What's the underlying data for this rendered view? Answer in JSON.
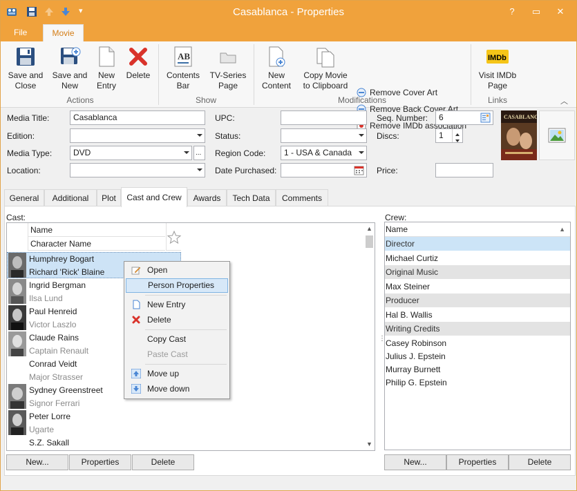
{
  "window": {
    "title": "Casablanca - Properties",
    "controls": {
      "help": "?",
      "restore": "▭",
      "close": "✕"
    }
  },
  "menu": {
    "file": "File",
    "movie": "Movie"
  },
  "ribbon": {
    "actions": {
      "label": "Actions",
      "save_close": [
        "Save and",
        "Close"
      ],
      "save_new": [
        "Save and",
        "New"
      ],
      "new_entry": [
        "New",
        "Entry"
      ],
      "delete": "Delete"
    },
    "show": {
      "label": "Show",
      "contents_bar": [
        "Contents",
        "Bar"
      ],
      "tv_series": [
        "TV-Series",
        "Page"
      ]
    },
    "modifications": {
      "label": "Modifications",
      "new_content": [
        "New",
        "Content"
      ],
      "copy_movie": [
        "Copy Movie",
        "to Clipboard"
      ],
      "remove_cover": "Remove Cover Art",
      "remove_back": "Remove Back Cover Art",
      "remove_imdb": "Remove IMDb association"
    },
    "links": {
      "label": "Links",
      "visit_imdb": [
        "Visit IMDb",
        "Page"
      ],
      "imdb_logo": "IMDb"
    }
  },
  "fields": {
    "media_title": {
      "label": "Media Title:",
      "value": "Casablanca"
    },
    "edition": {
      "label": "Edition:",
      "value": ""
    },
    "media_type": {
      "label": "Media Type:",
      "value": "DVD",
      "more": "..."
    },
    "location": {
      "label": "Location:",
      "value": ""
    },
    "upc": {
      "label": "UPC:",
      "value": ""
    },
    "status": {
      "label": "Status:",
      "value": ""
    },
    "region_code": {
      "label": "Region Code:",
      "value": "1 - USA & Canada"
    },
    "date_purchased": {
      "label": "Date Purchased:",
      "value": ""
    },
    "seq_number": {
      "label": "Seq. Number:",
      "value": "6"
    },
    "discs": {
      "label": "Discs:",
      "value": "1"
    },
    "price": {
      "label": "Price:",
      "value": ""
    }
  },
  "tabs": [
    "General",
    "Additional",
    "Plot",
    "Cast and Crew",
    "Awards",
    "Tech Data",
    "Comments"
  ],
  "active_tab": "Cast and Crew",
  "cast": {
    "label": "Cast:",
    "headers": {
      "name": "Name",
      "character": "Character Name"
    },
    "rows": [
      {
        "name": "Humphrey Bogart",
        "character": "Richard 'Rick' Blaine"
      },
      {
        "name": "Ingrid Bergman",
        "character": "Ilsa Lund"
      },
      {
        "name": "Paul Henreid",
        "character": "Victor Laszlo"
      },
      {
        "name": "Claude Rains",
        "character": "Captain Renault"
      },
      {
        "name": "Conrad Veidt",
        "character": "Major Strasser"
      },
      {
        "name": "Sydney Greenstreet",
        "character": "Signor Ferrari"
      },
      {
        "name": "Peter Lorre",
        "character": "Ugarte"
      },
      {
        "name": "S.Z. Sakall",
        "character": ""
      }
    ]
  },
  "crew": {
    "label": "Crew:",
    "header": "Name",
    "rows": [
      {
        "text": "Director",
        "type": "group"
      },
      {
        "text": "Michael Curtiz",
        "type": "item"
      },
      {
        "text": "Original Music",
        "type": "group"
      },
      {
        "text": "Max Steiner",
        "type": "item"
      },
      {
        "text": "Producer",
        "type": "group"
      },
      {
        "text": "Hal B. Wallis",
        "type": "item"
      },
      {
        "text": "Writing Credits",
        "type": "group"
      },
      {
        "text": "Casey Robinson",
        "type": "item"
      },
      {
        "text": "Julius J. Epstein",
        "type": "item"
      },
      {
        "text": "Murray Burnett",
        "type": "item"
      },
      {
        "text": "Philip G. Epstein",
        "type": "item"
      }
    ]
  },
  "buttons": {
    "new": "New...",
    "properties": "Properties",
    "delete": "Delete"
  },
  "context_menu": {
    "open": "Open",
    "person_properties": "Person Properties",
    "new_entry": "New Entry",
    "delete": "Delete",
    "copy_cast": "Copy Cast",
    "paste_cast": "Paste Cast",
    "move_up": "Move up",
    "move_down": "Move down"
  },
  "colors": {
    "accent": "#f0a23c",
    "highlight": "#cce4f7",
    "delete_red": "#d9332b"
  }
}
